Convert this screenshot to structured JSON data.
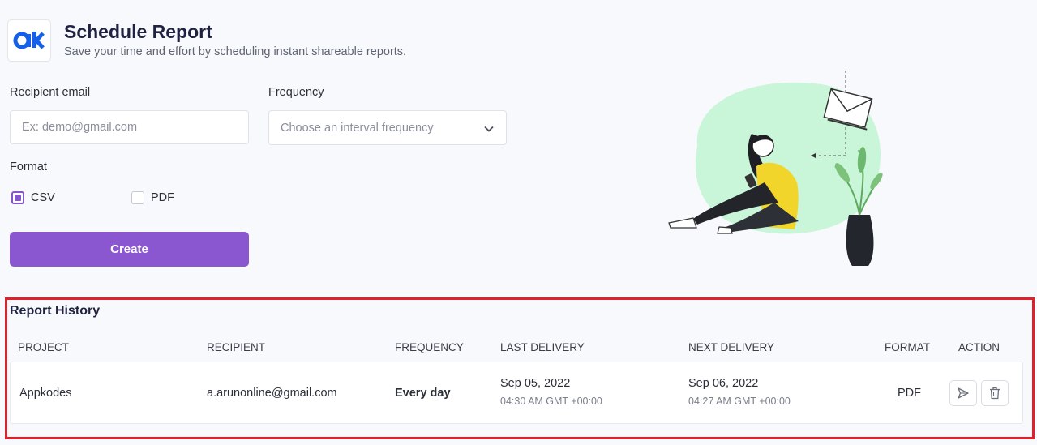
{
  "header": {
    "title": "Schedule Report",
    "subtitle": "Save your time and effort by scheduling instant shareable reports."
  },
  "form": {
    "recipient_label": "Recipient email",
    "recipient_placeholder": "Ex: demo@gmail.com",
    "frequency_label": "Frequency",
    "frequency_placeholder": "Choose an interval frequency",
    "format_label": "Format",
    "format_options": [
      {
        "label": "CSV",
        "checked": true
      },
      {
        "label": "PDF",
        "checked": false
      }
    ],
    "create_label": "Create"
  },
  "history": {
    "title": "Report History",
    "columns": [
      "PROJECT",
      "RECIPIENT",
      "FREQUENCY",
      "LAST DELIVERY",
      "NEXT DELIVERY",
      "FORMAT",
      "ACTION"
    ],
    "rows": [
      {
        "project": "Appkodes",
        "recipient": "a.arunonline@gmail.com",
        "frequency": "Every day",
        "last_date": "Sep 05, 2022",
        "last_time": "04:30 AM GMT +00:00",
        "next_date": "Sep 06, 2022",
        "next_time": "04:27 AM GMT +00:00",
        "format": "PDF"
      }
    ]
  },
  "colors": {
    "accent": "#8a57d0",
    "highlight_border": "#e0202a",
    "illustration_blob": "#c9f5d8"
  },
  "icons": [
    "appkodes-logo",
    "chevron-down-icon",
    "send-icon",
    "trash-icon"
  ]
}
